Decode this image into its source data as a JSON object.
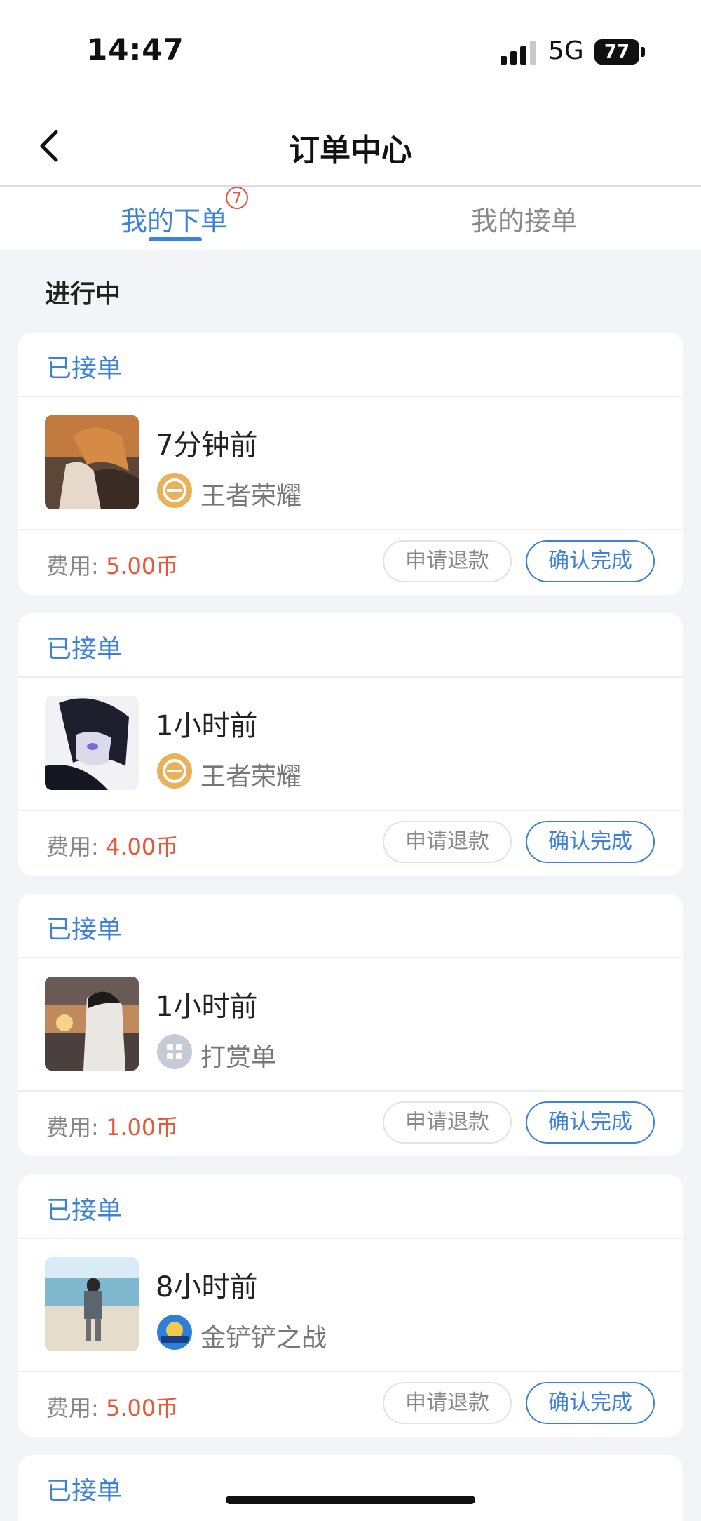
{
  "status_bar": {
    "time": "14:47",
    "network": "5G",
    "battery": "77"
  },
  "header": {
    "title": "订单中心"
  },
  "tabs": [
    {
      "label": "我的下单",
      "badge": "7",
      "active": true
    },
    {
      "label": "我的接单",
      "active": false
    }
  ],
  "section": {
    "title": "进行中"
  },
  "orders": [
    {
      "status": "已接单",
      "time_ago": "7分钟前",
      "game": "王者荣耀",
      "game_icon": "honor-of-kings-icon",
      "fee_label": "费用:",
      "fee_value": "5.00币",
      "refund_label": "申请退款",
      "confirm_label": "确认完成"
    },
    {
      "status": "已接单",
      "time_ago": "1小时前",
      "game": "王者荣耀",
      "game_icon": "honor-of-kings-icon",
      "fee_label": "费用:",
      "fee_value": "4.00币",
      "refund_label": "申请退款",
      "confirm_label": "确认完成"
    },
    {
      "status": "已接单",
      "time_ago": "1小时前",
      "game": "打赏单",
      "game_icon": "tip-order-icon",
      "fee_label": "费用:",
      "fee_value": "1.00币",
      "refund_label": "申请退款",
      "confirm_label": "确认完成"
    },
    {
      "status": "已接单",
      "time_ago": "8小时前",
      "game": "金铲铲之战",
      "game_icon": "golden-spatula-icon",
      "fee_label": "费用:",
      "fee_value": "5.00币",
      "refund_label": "申请退款",
      "confirm_label": "确认完成"
    },
    {
      "status": "已接单"
    }
  ],
  "colors": {
    "accent": "#3b82d8",
    "price": "#e65a3a",
    "background": "#f3f4f8"
  }
}
